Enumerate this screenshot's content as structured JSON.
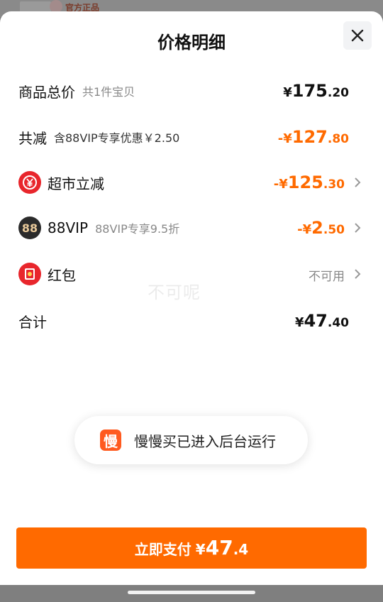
{
  "background": {
    "label": "官方正品"
  },
  "sheet": {
    "title": "价格明细",
    "rows": {
      "total": {
        "label": "商品总价",
        "sub": "共1件宝贝",
        "currency": "¥",
        "amount_int": "175",
        "amount_dec": ".20"
      },
      "discount": {
        "label": "共减",
        "sub": "含88VIP专享优惠￥2.50",
        "currency": "-¥",
        "amount_int": "127",
        "amount_dec": ".80"
      },
      "supermarket": {
        "label": "超市立减",
        "icon": "yen-circle-icon",
        "currency": "-¥",
        "amount_int": "125",
        "amount_dec": ".30"
      },
      "vip": {
        "label": "88VIP",
        "sub": "88VIP专享9.5折",
        "icon_text": "88",
        "currency": "-¥",
        "amount_int": "2",
        "amount_dec": ".50"
      },
      "redpacket": {
        "label": "红包",
        "icon": "red-packet-icon",
        "status": "不可用"
      },
      "sum": {
        "label": "合计",
        "currency": "¥",
        "amount_int": "47",
        "amount_dec": ".40"
      }
    },
    "watermark": "不可呢"
  },
  "toast": {
    "icon_text": "慢",
    "message": "慢慢买已进入后台运行"
  },
  "pay_button": {
    "label": "立即支付",
    "currency": "¥",
    "amount_int": "47",
    "amount_dec": ".4"
  },
  "colors": {
    "accent": "#ff6a00",
    "coupon_red": "#e8262c",
    "vip_dark": "#2b2b2b"
  }
}
